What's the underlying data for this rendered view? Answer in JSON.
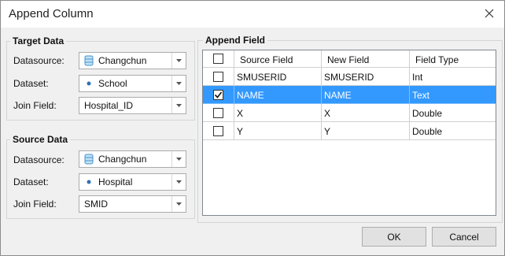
{
  "dialog": {
    "title": "Append Column"
  },
  "target": {
    "group_title": "Target Data",
    "datasource_label": "Datasource:",
    "datasource_value": "Changchun",
    "dataset_label": "Dataset:",
    "dataset_value": "School",
    "joinfield_label": "Join Field:",
    "joinfield_value": "Hospital_ID"
  },
  "source": {
    "group_title": "Source Data",
    "datasource_label": "Datasource:",
    "datasource_value": "Changchun",
    "dataset_label": "Dataset:",
    "dataset_value": "Hospital",
    "joinfield_label": "Join Field:",
    "joinfield_value": "SMID"
  },
  "append": {
    "group_title": "Append Field",
    "columns": [
      "Source Field",
      "New Field",
      "Field Type"
    ],
    "rows": [
      {
        "source": "SMUSERID",
        "new": "SMUSERID",
        "type": "Int",
        "checked": false,
        "selected": false
      },
      {
        "source": "NAME",
        "new": "NAME",
        "type": "Text",
        "checked": true,
        "selected": true
      },
      {
        "source": "X",
        "new": "X",
        "type": "Double",
        "checked": false,
        "selected": false
      },
      {
        "source": "Y",
        "new": "Y",
        "type": "Double",
        "checked": false,
        "selected": false
      }
    ]
  },
  "buttons": {
    "ok": "OK",
    "cancel": "Cancel"
  },
  "colors": {
    "selection": "#3399ff",
    "border": "#ababab"
  }
}
